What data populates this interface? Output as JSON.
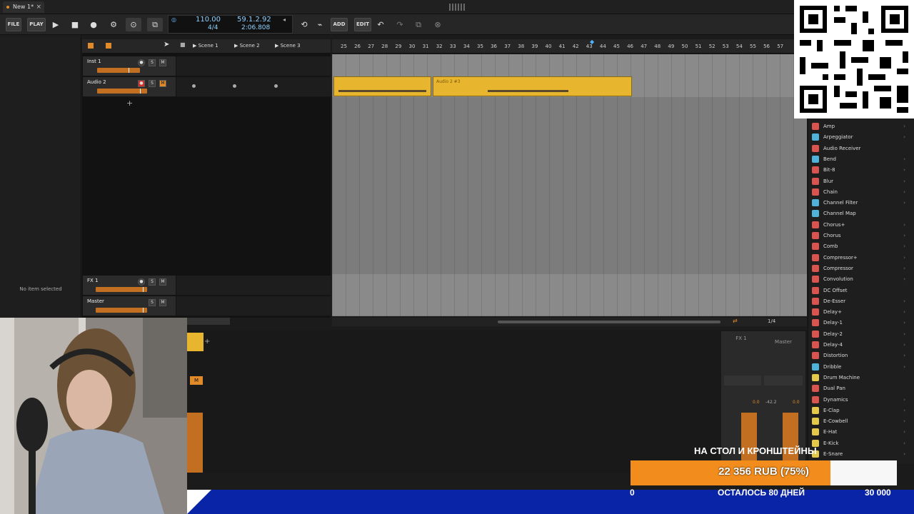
{
  "app": {
    "doc_tab": "New 1*"
  },
  "toolbar": {
    "file": "FILE",
    "play_mode": "PLAY",
    "add": "ADD",
    "edit": "EDIT",
    "tempo": "110.00",
    "time_signature": "4/4",
    "position_bars": "59.1.2.92",
    "position_time": "2:06.808"
  },
  "left_panel": {
    "empty_text": "No item selected"
  },
  "scenes": [
    "Scene 1",
    "Scene 2",
    "Scene 3"
  ],
  "tracks": [
    {
      "name": "Inst 1",
      "solo": "S",
      "mute": "M"
    },
    {
      "name": "Audio 2",
      "solo": "S",
      "mute": "M"
    },
    {
      "name": "FX 1",
      "solo": "S",
      "mute": "M"
    },
    {
      "name": "Master",
      "solo": "S",
      "mute": "M"
    }
  ],
  "ruler": [
    "25",
    "26",
    "27",
    "28",
    "29",
    "30",
    "31",
    "32",
    "33",
    "34",
    "35",
    "36",
    "37",
    "38",
    "39",
    "40",
    "41",
    "42",
    "43",
    "44",
    "45",
    "46",
    "47",
    "48",
    "49",
    "50",
    "51",
    "52",
    "53",
    "54",
    "55",
    "56",
    "57"
  ],
  "clips": [
    {
      "label": ""
    },
    {
      "label": "Audio 2 #3"
    }
  ],
  "grid": {
    "quantize": "1/4"
  },
  "mixer": {
    "fx_label": "FX 1",
    "master_label": "Master",
    "mute_label": "M",
    "db_1": "-42.2",
    "db_2": "0.0",
    "db_3": "0.0"
  },
  "browser": {
    "items": [
      {
        "label": "Amp",
        "color": "#d9534f",
        "chev": true
      },
      {
        "label": "Arpeggiator",
        "color": "#4fb3d9",
        "chev": true
      },
      {
        "label": "Audio Receiver",
        "color": "#d9534f",
        "chev": false
      },
      {
        "label": "Bend",
        "color": "#4fb3d9",
        "chev": true
      },
      {
        "label": "Bit-8",
        "color": "#d9534f",
        "chev": true
      },
      {
        "label": "Blur",
        "color": "#d9534f",
        "chev": true
      },
      {
        "label": "Chain",
        "color": "#d9534f",
        "chev": true
      },
      {
        "label": "Channel Filter",
        "color": "#4fb3d9",
        "chev": true
      },
      {
        "label": "Channel Map",
        "color": "#4fb3d9",
        "chev": false
      },
      {
        "label": "Chorus+",
        "color": "#d9534f",
        "chev": true
      },
      {
        "label": "Chorus",
        "color": "#d9534f",
        "chev": true
      },
      {
        "label": "Comb",
        "color": "#d9534f",
        "chev": true
      },
      {
        "label": "Compressor+",
        "color": "#d9534f",
        "chev": true
      },
      {
        "label": "Compressor",
        "color": "#d9534f",
        "chev": true
      },
      {
        "label": "Convolution",
        "color": "#d9534f",
        "chev": true
      },
      {
        "label": "DC Offset",
        "color": "#d9534f",
        "chev": false
      },
      {
        "label": "De-Esser",
        "color": "#d9534f",
        "chev": true
      },
      {
        "label": "Delay+",
        "color": "#d9534f",
        "chev": true
      },
      {
        "label": "Delay-1",
        "color": "#d9534f",
        "chev": true
      },
      {
        "label": "Delay-2",
        "color": "#d9534f",
        "chev": true
      },
      {
        "label": "Delay-4",
        "color": "#d9534f",
        "chev": true
      },
      {
        "label": "Distortion",
        "color": "#d9534f",
        "chev": true
      },
      {
        "label": "Dribble",
        "color": "#4fb3d9",
        "chev": true
      },
      {
        "label": "Drum Machine",
        "color": "#e3c84a",
        "chev": false
      },
      {
        "label": "Dual Pan",
        "color": "#d9534f",
        "chev": false
      },
      {
        "label": "Dynamics",
        "color": "#d9534f",
        "chev": true
      },
      {
        "label": "E-Clap",
        "color": "#e3c84a",
        "chev": true
      },
      {
        "label": "E-Cowbell",
        "color": "#e3c84a",
        "chev": true
      },
      {
        "label": "E-Hat",
        "color": "#e3c84a",
        "chev": true
      },
      {
        "label": "E-Kick",
        "color": "#e3c84a",
        "chev": true
      },
      {
        "label": "E-Snare",
        "color": "#e3c84a",
        "chev": true
      }
    ]
  },
  "donation": {
    "title": "НА СТОЛ И КРОНШТЕЙНЫ",
    "amount": "22 356 RUB (75%)",
    "progress": 0.75,
    "min": "0",
    "remaining": "ОСТАЛОСЬ 80 ДНЕЙ",
    "goal": "30 000"
  }
}
